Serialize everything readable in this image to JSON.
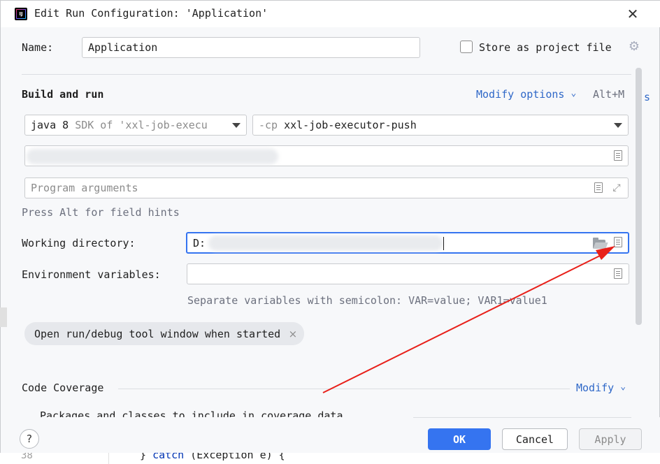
{
  "window": {
    "title": "Edit Run Configuration: 'Application'",
    "close_icon": "close-icon"
  },
  "name_row": {
    "label": "Name:",
    "value": "Application",
    "store_label": "Store as project file",
    "store_checked": false
  },
  "build_and_run": {
    "title": "Build and run",
    "modify_options": "Modify options",
    "modify_chevron": "⌄",
    "shortcut": "Alt+M",
    "sdk": {
      "main": "java 8",
      "secondary": "SDK of 'xxl-job-execu"
    },
    "classpath": {
      "prefix": "-cp",
      "value": "xxl-job-executor-push"
    },
    "program_arguments_placeholder": "Program arguments",
    "hint": "Press Alt for field hints"
  },
  "working_directory": {
    "label": "Working directory:",
    "value": "D:"
  },
  "environment_variables": {
    "label": "Environment variables:",
    "hint": "Separate variables with semicolon: VAR=value; VAR1=value1"
  },
  "chip": {
    "label": "Open run/debug tool window when started",
    "remove": "×"
  },
  "code_coverage": {
    "title": "Code Coverage",
    "modify": "Modify",
    "modify_chevron": "⌄",
    "packages_text": "Packages and classes to include in coverage data"
  },
  "footer": {
    "help": "?",
    "ok": "OK",
    "cancel": "Cancel",
    "apply": "Apply"
  },
  "background": {
    "line_number": "38",
    "code_brace": "}",
    "code_kw": "catch",
    "code_rest": "(Exception e) {",
    "right_edge_text": "s"
  },
  "annotation": {
    "arrow_color": "#e8201a"
  },
  "colors": {
    "accent": "#3574f0",
    "link": "#2f68c8"
  }
}
